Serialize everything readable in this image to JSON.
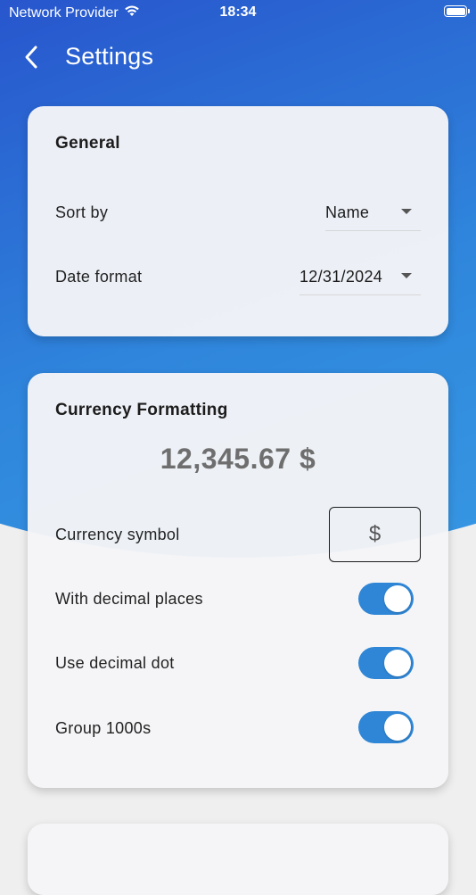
{
  "status_bar": {
    "carrier": "Network Provider",
    "time": "18:34"
  },
  "app_bar": {
    "title": "Settings"
  },
  "general": {
    "title": "General",
    "sort_by": {
      "label": "Sort by",
      "value": "Name"
    },
    "date_format": {
      "label": "Date format",
      "value": "12/31/2024"
    }
  },
  "currency": {
    "title": "Currency Formatting",
    "preview": "12,345.67 $",
    "symbol": {
      "label": "Currency symbol",
      "value": "$"
    },
    "toggles": [
      {
        "label": "With decimal places",
        "on": true
      },
      {
        "label": "Use decimal dot",
        "on": true
      },
      {
        "label": "Group 1000s",
        "on": true
      }
    ]
  },
  "icons": {
    "back": "chevron-left-icon",
    "wifi": "wifi-icon",
    "battery": "battery-icon",
    "dropdown": "caret-down-icon"
  },
  "colors": {
    "gradient_start": "#1f23b8",
    "gradient_end": "#3a9fe6",
    "toggle_on": "#2f86d6",
    "background": "#efefef"
  }
}
